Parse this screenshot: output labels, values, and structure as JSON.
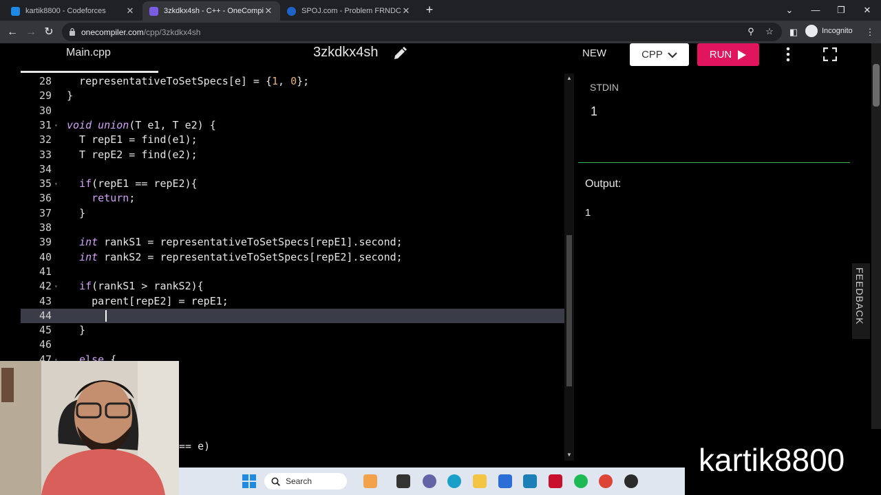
{
  "browser": {
    "tabs": [
      {
        "title": "kartik8800 - Codeforces",
        "favicon_color": "#1e88e5",
        "active": false
      },
      {
        "title": "3zkdkx4sh - C++ - OneCompiler",
        "favicon_color": "#7b5ce5",
        "active": true
      },
      {
        "title": "SPOJ.com - Problem FRNDCIRC",
        "favicon_color": "#1e63c8",
        "active": false
      }
    ],
    "new_tab": "+",
    "url_host": "onecompiler.com",
    "url_path": "/cpp/3zkdkx4sh",
    "profile": "Incognito"
  },
  "app": {
    "file_tab": "Main.cpp",
    "title": "3zkdkx4sh",
    "new_label": "NEW",
    "language": "CPP",
    "run_label": "RUN",
    "accent": "#e0155e"
  },
  "editor": {
    "cursor_line": 44,
    "lines": [
      {
        "n": "28",
        "fold": "",
        "segs": [
          {
            "t": "  representativeToSetSpecs[e] = {",
            "c": ""
          },
          {
            "t": "1",
            "c": "num"
          },
          {
            "t": ", ",
            "c": ""
          },
          {
            "t": "0",
            "c": "num"
          },
          {
            "t": "};",
            "c": ""
          }
        ]
      },
      {
        "n": "29",
        "fold": "",
        "segs": [
          {
            "t": "}",
            "c": ""
          }
        ]
      },
      {
        "n": "30",
        "fold": "",
        "segs": []
      },
      {
        "n": "31",
        "fold": "▾",
        "segs": [
          {
            "t": "void",
            "c": "kw"
          },
          {
            "t": " ",
            "c": ""
          },
          {
            "t": "union",
            "c": "kw"
          },
          {
            "t": "(T e1, T e2) {",
            "c": ""
          }
        ]
      },
      {
        "n": "32",
        "fold": "",
        "segs": [
          {
            "t": "  T repE1 = find(e1);",
            "c": ""
          }
        ]
      },
      {
        "n": "33",
        "fold": "",
        "segs": [
          {
            "t": "  T repE2 = find(e2);",
            "c": ""
          }
        ]
      },
      {
        "n": "34",
        "fold": "",
        "segs": []
      },
      {
        "n": "35",
        "fold": "▾",
        "segs": [
          {
            "t": "  ",
            "c": ""
          },
          {
            "t": "if",
            "c": "ctl"
          },
          {
            "t": "(repE1 == repE2){",
            "c": ""
          }
        ]
      },
      {
        "n": "36",
        "fold": "",
        "segs": [
          {
            "t": "    ",
            "c": ""
          },
          {
            "t": "return",
            "c": "ctl"
          },
          {
            "t": ";",
            "c": ""
          }
        ]
      },
      {
        "n": "37",
        "fold": "",
        "segs": [
          {
            "t": "  }",
            "c": ""
          }
        ]
      },
      {
        "n": "38",
        "fold": "",
        "segs": []
      },
      {
        "n": "39",
        "fold": "",
        "segs": [
          {
            "t": "  ",
            "c": ""
          },
          {
            "t": "int",
            "c": "kw"
          },
          {
            "t": " rankS1 = representativeToSetSpecs[repE1].second;",
            "c": ""
          }
        ]
      },
      {
        "n": "40",
        "fold": "",
        "segs": [
          {
            "t": "  ",
            "c": ""
          },
          {
            "t": "int",
            "c": "kw"
          },
          {
            "t": " rankS2 = representativeToSetSpecs[repE2].second;",
            "c": ""
          }
        ]
      },
      {
        "n": "41",
        "fold": "",
        "segs": []
      },
      {
        "n": "42",
        "fold": "▾",
        "segs": [
          {
            "t": "  ",
            "c": ""
          },
          {
            "t": "if",
            "c": "ctl"
          },
          {
            "t": "(rankS1 > rankS2){",
            "c": ""
          }
        ]
      },
      {
        "n": "43",
        "fold": "",
        "segs": [
          {
            "t": "    parent[repE2] = repE1;",
            "c": ""
          }
        ]
      },
      {
        "n": "44",
        "fold": "",
        "segs": []
      },
      {
        "n": "45",
        "fold": "",
        "segs": [
          {
            "t": "  }",
            "c": ""
          }
        ]
      },
      {
        "n": "46",
        "fold": "",
        "segs": []
      },
      {
        "n": "47",
        "fold": "▾",
        "segs": [
          {
            "t": "  ",
            "c": ""
          },
          {
            "t": "else",
            "c": "ctl"
          },
          {
            "t": " {",
            "c": ""
          }
        ]
      }
    ],
    "partial_line": "== e)"
  },
  "io": {
    "stdin_label": "STDIN",
    "stdin_value": "1",
    "output_label": "Output:",
    "output_value": "1"
  },
  "feedback_label": "FEEDBACK",
  "taskbar": {
    "search_placeholder": "Search"
  },
  "watermark": "kartik8800"
}
